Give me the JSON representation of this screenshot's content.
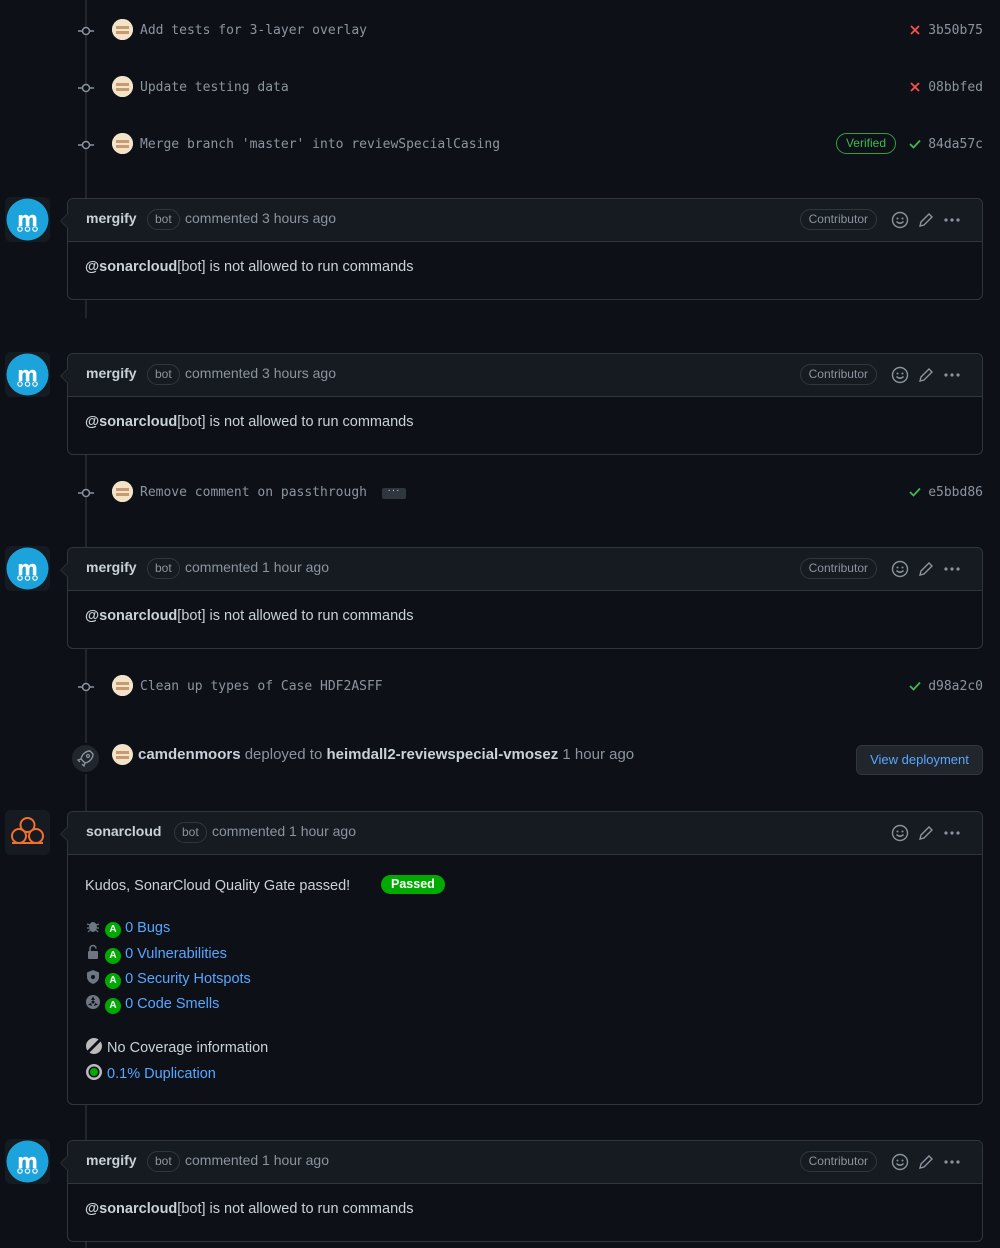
{
  "commits": [
    {
      "message": "Add tests for 3-layer overlay",
      "sha": "3b50b75",
      "status": "fail"
    },
    {
      "message": "Update testing data",
      "sha": "08bbfed",
      "status": "fail"
    },
    {
      "message": "Merge branch 'master' into reviewSpecialCasing",
      "sha": "84da57c",
      "status": "ok",
      "verified": "Verified"
    },
    {
      "message": "Remove comment on passthrough",
      "sha": "e5bbd86",
      "status": "ok",
      "ellipsis": "···"
    },
    {
      "message": "Clean up types of Case HDF2ASFF",
      "sha": "d98a2c0",
      "status": "ok"
    }
  ],
  "comments": [
    {
      "author": "mergify",
      "bot": "bot",
      "when": "commented 3 hours ago",
      "role": "Contributor",
      "mention": "@sonarcloud",
      "text": "[bot] is not allowed to run commands"
    },
    {
      "author": "mergify",
      "bot": "bot",
      "when": "commented 3 hours ago",
      "role": "Contributor",
      "mention": "@sonarcloud",
      "text": "[bot] is not allowed to run commands"
    },
    {
      "author": "mergify",
      "bot": "bot",
      "when": "commented 1 hour ago",
      "role": "Contributor",
      "mention": "@sonarcloud",
      "text": "[bot] is not allowed to run commands"
    },
    {
      "author": "mergify",
      "bot": "bot",
      "when": "commented 1 hour ago",
      "role": "Contributor",
      "mention": "@sonarcloud",
      "text": "[bot] is not allowed to run commands"
    }
  ],
  "deploy": {
    "user": "camdenmoors",
    "action": "deployed to",
    "env": "heimdall2-reviewspecial-vmosez",
    "when": "1 hour ago",
    "button": "View deployment"
  },
  "sonar": {
    "author": "sonarcloud",
    "bot": "bot",
    "when": "commented 1 hour ago",
    "headline": "Kudos, SonarCloud Quality Gate passed!",
    "badge": "Passed",
    "grade": "A",
    "bugs": "0 Bugs",
    "vulnerabilities": "0 Vulnerabilities",
    "hotspots": "0 Security Hotspots",
    "smells": "0 Code Smells",
    "coverage": "No Coverage information",
    "duplication": "0.1% Duplication"
  },
  "colors": {
    "fail": "#f85149",
    "ok": "#3fb950",
    "link": "#58a6ff",
    "grade": "#00aa00"
  }
}
